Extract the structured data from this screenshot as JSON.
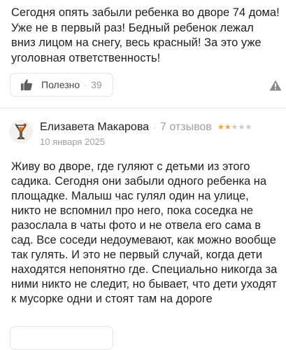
{
  "reviews": [
    {
      "text": "Сегодня опять забыли ребенка во дворе 74 дома! Уже не в первый раз! Бедный ребенок лежал вниз лицом на снегу, весь красный! За это уже уголовная ответственность!",
      "like_label": "Полезно",
      "like_count": "39",
      "like_icon": "thumbs-up-icon",
      "report_icon": "warning-triangle-icon"
    },
    {
      "author": "Елизавета Макарова",
      "author_reviews": "7 отзывов",
      "rating": 2,
      "rating_max": 5,
      "date": "10 января 2025",
      "text": "Живу во дворе, где гуляют с детьми из этого садика. Сегодня они забыли одного ребенка на площадке. Малыш час гулял один на улице, никто не вспомнил про него, пока соседка не разослала в чаты фото и не отвела его сама в сад. Все соседи недоумевают, как можно вообще так гулять. И это не первый случай, когда дети находятся непонятно где. Специально никогда за ними никто не следит, но бывает, что дети уходят к мусорке одни и стоят там на дороге",
      "avatar": "cocktail-glass-avatar"
    }
  ],
  "colors": {
    "star_filled": "#f5a623",
    "star_empty": "#c9c9c9",
    "muted_text": "#9e9e9e",
    "border": "#e3e3e3"
  }
}
